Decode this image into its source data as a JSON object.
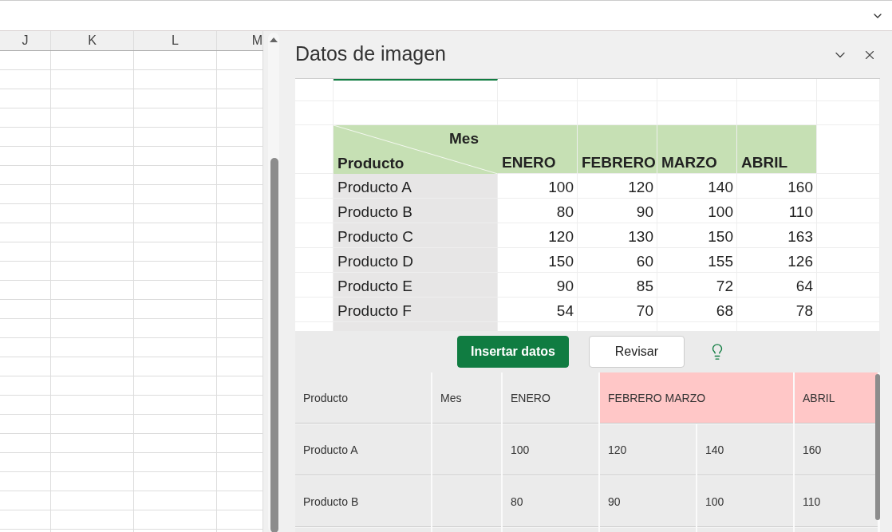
{
  "sheet": {
    "columns": [
      "J",
      "K",
      "L",
      "M"
    ]
  },
  "panel": {
    "title": "Datos de imagen",
    "image_table": {
      "corner_top": "Mes",
      "corner_bottom": "Producto",
      "months": [
        "ENERO",
        "FEBRERO",
        "MARZO",
        "ABRIL"
      ],
      "rows": [
        {
          "product": "Producto A",
          "values": [
            "100",
            "120",
            "140",
            "160"
          ]
        },
        {
          "product": "Producto B",
          "values": [
            "80",
            "90",
            "100",
            "110"
          ]
        },
        {
          "product": "Producto C",
          "values": [
            "120",
            "130",
            "150",
            "163"
          ]
        },
        {
          "product": "Producto D",
          "values": [
            "150",
            "60",
            "155",
            "126"
          ]
        },
        {
          "product": "Producto E",
          "values": [
            "90",
            "85",
            "72",
            "64"
          ]
        },
        {
          "product": "Producto F",
          "values": [
            "54",
            "70",
            "68",
            "78"
          ]
        }
      ]
    },
    "buttons": [
      {
        "label": "Insertar datos",
        "kind": "primary"
      },
      {
        "label": "Revisar",
        "kind": "secondary"
      }
    ],
    "preview": {
      "header": [
        {
          "label": "Producto",
          "error": false,
          "merged": false
        },
        {
          "label": "Mes",
          "error": false,
          "merged": false
        },
        {
          "label": "ENERO",
          "error": false,
          "merged": false
        },
        {
          "label": "FEBRERO MARZO",
          "error": true,
          "merged": true
        },
        {
          "label": "ABRIL",
          "error": true,
          "merged": false
        }
      ],
      "rows": [
        {
          "product": "Producto A",
          "values": [
            "100",
            "120",
            "140",
            "160"
          ]
        },
        {
          "product": "Producto B",
          "values": [
            "80",
            "90",
            "100",
            "110"
          ]
        }
      ]
    }
  }
}
